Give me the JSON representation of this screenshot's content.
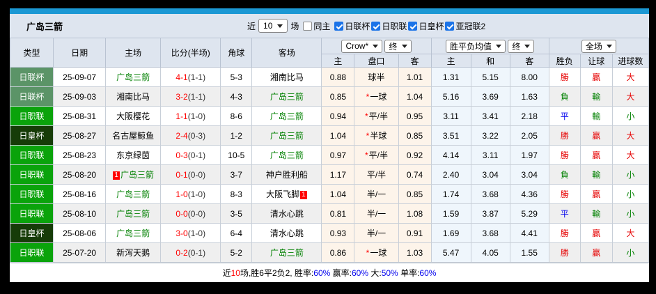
{
  "window": {
    "title": "广岛三箭"
  },
  "controls": {
    "recent_prefix": "近",
    "recent_count": "10",
    "recent_suffix": "场",
    "same_home": {
      "label": "同主",
      "checked": false
    },
    "filters": [
      {
        "label": "日联杯",
        "checked": true
      },
      {
        "label": "日职联",
        "checked": true
      },
      {
        "label": "日皇杯",
        "checked": true
      },
      {
        "label": "亚冠联2",
        "checked": true
      }
    ]
  },
  "table": {
    "columns": [
      "类型",
      "日期",
      "主场",
      "比分(半场)",
      "角球",
      "客场"
    ],
    "selects": {
      "bookmaker": "Crow*",
      "handicap_state": "终",
      "avg_type": "胜平负均值",
      "avg_state": "终",
      "scope": "全场"
    },
    "sub_columns": [
      "主",
      "盘口",
      "客",
      "主",
      "和",
      "客",
      "胜负",
      "让球",
      "进球数"
    ],
    "rows": [
      {
        "type": "日联杯",
        "date": "25-09-07",
        "home": {
          "name": "广岛三箭",
          "self": true,
          "badge": ""
        },
        "score": "4-1",
        "half": "(1-1)",
        "corner": "5-3",
        "away": {
          "name": "湘南比马",
          "self": false,
          "badge": ""
        },
        "handicap": {
          "home": "0.88",
          "star": false,
          "line": "球半",
          "away": "1.01"
        },
        "avg": {
          "home": "1.31",
          "draw": "5.15",
          "away": "8.00"
        },
        "result": {
          "outcome": "勝",
          "outcome_key": "win",
          "handicap": "贏",
          "handicap_key": "win",
          "goals": "大",
          "goals_key": "big"
        }
      },
      {
        "type": "日联杯",
        "date": "25-09-03",
        "home": {
          "name": "湘南比马",
          "self": false,
          "badge": ""
        },
        "score": "3-2",
        "half": "(1-1)",
        "corner": "4-3",
        "away": {
          "name": "广岛三箭",
          "self": true,
          "badge": ""
        },
        "handicap": {
          "home": "0.85",
          "star": true,
          "line": "一球",
          "away": "1.04"
        },
        "avg": {
          "home": "5.16",
          "draw": "3.69",
          "away": "1.63"
        },
        "result": {
          "outcome": "負",
          "outcome_key": "loss",
          "handicap": "輸",
          "handicap_key": "loss",
          "goals": "大",
          "goals_key": "big"
        }
      },
      {
        "type": "日职联",
        "date": "25-08-31",
        "home": {
          "name": "大阪樱花",
          "self": false,
          "badge": ""
        },
        "score": "1-1",
        "half": "(1-0)",
        "corner": "8-6",
        "away": {
          "name": "广岛三箭",
          "self": true,
          "badge": ""
        },
        "handicap": {
          "home": "0.94",
          "star": true,
          "line": "平/半",
          "away": "0.95"
        },
        "avg": {
          "home": "3.11",
          "draw": "3.41",
          "away": "2.18"
        },
        "result": {
          "outcome": "平",
          "outcome_key": "draw",
          "handicap": "輸",
          "handicap_key": "loss",
          "goals": "小",
          "goals_key": "small"
        }
      },
      {
        "type": "日皇杯",
        "date": "25-08-27",
        "home": {
          "name": "名古屋鲸鱼",
          "self": false,
          "badge": ""
        },
        "score": "2-4",
        "half": "(0-3)",
        "corner": "1-2",
        "away": {
          "name": "广岛三箭",
          "self": true,
          "badge": ""
        },
        "handicap": {
          "home": "1.04",
          "star": true,
          "line": "半球",
          "away": "0.85"
        },
        "avg": {
          "home": "3.51",
          "draw": "3.22",
          "away": "2.05"
        },
        "result": {
          "outcome": "勝",
          "outcome_key": "win",
          "handicap": "贏",
          "handicap_key": "win",
          "goals": "大",
          "goals_key": "big"
        }
      },
      {
        "type": "日职联",
        "date": "25-08-23",
        "home": {
          "name": "东京绿茵",
          "self": false,
          "badge": ""
        },
        "score": "0-3",
        "half": "(0-1)",
        "corner": "10-5",
        "away": {
          "name": "广岛三箭",
          "self": true,
          "badge": ""
        },
        "handicap": {
          "home": "0.97",
          "star": true,
          "line": "平/半",
          "away": "0.92"
        },
        "avg": {
          "home": "4.14",
          "draw": "3.11",
          "away": "1.97"
        },
        "result": {
          "outcome": "勝",
          "outcome_key": "win",
          "handicap": "贏",
          "handicap_key": "win",
          "goals": "大",
          "goals_key": "big"
        }
      },
      {
        "type": "日职联",
        "date": "25-08-20",
        "home": {
          "name": "广岛三箭",
          "self": true,
          "badge": "1"
        },
        "score": "0-1",
        "half": "(0-0)",
        "corner": "3-7",
        "away": {
          "name": "神户胜利船",
          "self": false,
          "badge": ""
        },
        "handicap": {
          "home": "1.17",
          "star": false,
          "line": "平/半",
          "away": "0.74"
        },
        "avg": {
          "home": "2.40",
          "draw": "3.04",
          "away": "3.04"
        },
        "result": {
          "outcome": "負",
          "outcome_key": "loss",
          "handicap": "輸",
          "handicap_key": "loss",
          "goals": "小",
          "goals_key": "small"
        }
      },
      {
        "type": "日职联",
        "date": "25-08-16",
        "home": {
          "name": "广岛三箭",
          "self": true,
          "badge": ""
        },
        "score": "1-0",
        "half": "(1-0)",
        "corner": "8-3",
        "away": {
          "name": "大阪飞脚",
          "self": false,
          "badge": "1"
        },
        "handicap": {
          "home": "1.04",
          "star": false,
          "line": "半/一",
          "away": "0.85"
        },
        "avg": {
          "home": "1.74",
          "draw": "3.68",
          "away": "4.36"
        },
        "result": {
          "outcome": "勝",
          "outcome_key": "win",
          "handicap": "贏",
          "handicap_key": "win",
          "goals": "小",
          "goals_key": "small"
        }
      },
      {
        "type": "日职联",
        "date": "25-08-10",
        "home": {
          "name": "广岛三箭",
          "self": true,
          "badge": ""
        },
        "score": "0-0",
        "half": "(0-0)",
        "corner": "3-5",
        "away": {
          "name": "清水心跳",
          "self": false,
          "badge": ""
        },
        "handicap": {
          "home": "0.81",
          "star": false,
          "line": "半/一",
          "away": "1.08"
        },
        "avg": {
          "home": "1.59",
          "draw": "3.87",
          "away": "5.29"
        },
        "result": {
          "outcome": "平",
          "outcome_key": "draw",
          "handicap": "輸",
          "handicap_key": "loss",
          "goals": "小",
          "goals_key": "small"
        }
      },
      {
        "type": "日皇杯",
        "date": "25-08-06",
        "home": {
          "name": "广岛三箭",
          "self": true,
          "badge": ""
        },
        "score": "3-0",
        "half": "(1-0)",
        "corner": "6-4",
        "away": {
          "name": "清水心跳",
          "self": false,
          "badge": ""
        },
        "handicap": {
          "home": "0.93",
          "star": false,
          "line": "半/一",
          "away": "0.91"
        },
        "avg": {
          "home": "1.69",
          "draw": "3.68",
          "away": "4.41"
        },
        "result": {
          "outcome": "勝",
          "outcome_key": "win",
          "handicap": "贏",
          "handicap_key": "win",
          "goals": "大",
          "goals_key": "big"
        }
      },
      {
        "type": "日职联",
        "date": "25-07-20",
        "home": {
          "name": "新泻天鹅",
          "self": false,
          "badge": ""
        },
        "score": "0-2",
        "half": "(0-1)",
        "corner": "5-2",
        "away": {
          "name": "广岛三箭",
          "self": true,
          "badge": ""
        },
        "handicap": {
          "home": "0.86",
          "star": true,
          "line": "一球",
          "away": "1.03"
        },
        "avg": {
          "home": "5.47",
          "draw": "4.05",
          "away": "1.55"
        },
        "result": {
          "outcome": "勝",
          "outcome_key": "win",
          "handicap": "贏",
          "handicap_key": "win",
          "goals": "小",
          "goals_key": "small"
        }
      }
    ]
  },
  "footer": {
    "segments": [
      {
        "text": "近",
        "color": "black"
      },
      {
        "text": "10",
        "color": "red"
      },
      {
        "text": "场,胜6平2负2, 胜率:",
        "color": "black"
      },
      {
        "text": "60%",
        "color": "blue"
      },
      {
        "text": " 赢率:",
        "color": "black"
      },
      {
        "text": "60%",
        "color": "blue"
      },
      {
        "text": " 大:",
        "color": "black"
      },
      {
        "text": "50%",
        "color": "blue"
      },
      {
        "text": " 单率:",
        "color": "black"
      },
      {
        "text": "60%",
        "color": "blue"
      }
    ]
  },
  "colors": {
    "accent_bar": "#1b98d4",
    "header_bg": "#dee5ef",
    "league_badge": {
      "日联杯": "#5b9467",
      "日职联": "#0aa30b",
      "日皇杯": "#163c08"
    },
    "self_team": "#008000",
    "score_red": "#ff0000",
    "win": "#e60000",
    "draw": "#0000ee",
    "loss": "#008000",
    "big": "#e60000",
    "small": "#008000",
    "stat_blue": "#0000ee"
  }
}
